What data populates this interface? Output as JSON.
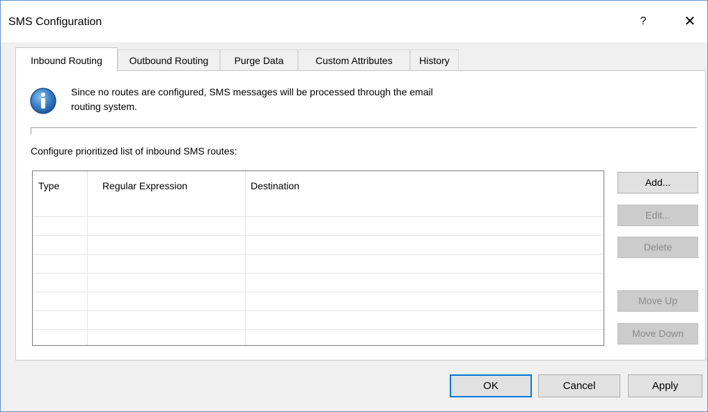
{
  "window": {
    "title": "SMS Configuration",
    "help_label": "?",
    "close_label": "✕"
  },
  "tabs": [
    {
      "label": "Inbound Routing",
      "selected": true
    },
    {
      "label": "Outbound Routing",
      "selected": false
    },
    {
      "label": "Purge Data",
      "selected": false
    },
    {
      "label": "Custom Attributes",
      "selected": false
    },
    {
      "label": "History",
      "selected": false
    }
  ],
  "info": {
    "icon": "info-icon",
    "line1": "Since no routes are configured, SMS messages will be processed through the email",
    "line2": "routing system."
  },
  "routes": {
    "label": "Configure prioritized list of inbound SMS routes:",
    "columns": [
      "Type",
      "Regular Expression",
      "Destination"
    ],
    "rows": []
  },
  "side_buttons": [
    {
      "label": "Add...",
      "enabled": true
    },
    {
      "label": "Edit...",
      "enabled": false
    },
    {
      "label": "Delete",
      "enabled": false
    },
    {
      "label": "Move Up",
      "enabled": false
    },
    {
      "label": "Move Down",
      "enabled": false
    }
  ],
  "dialog_buttons": {
    "ok": "OK",
    "cancel": "Cancel",
    "apply": "Apply"
  },
  "colors": {
    "window_border": "#5b8fc7",
    "default_button_border": "#0078d7",
    "info_icon": "#3b7fc4"
  }
}
